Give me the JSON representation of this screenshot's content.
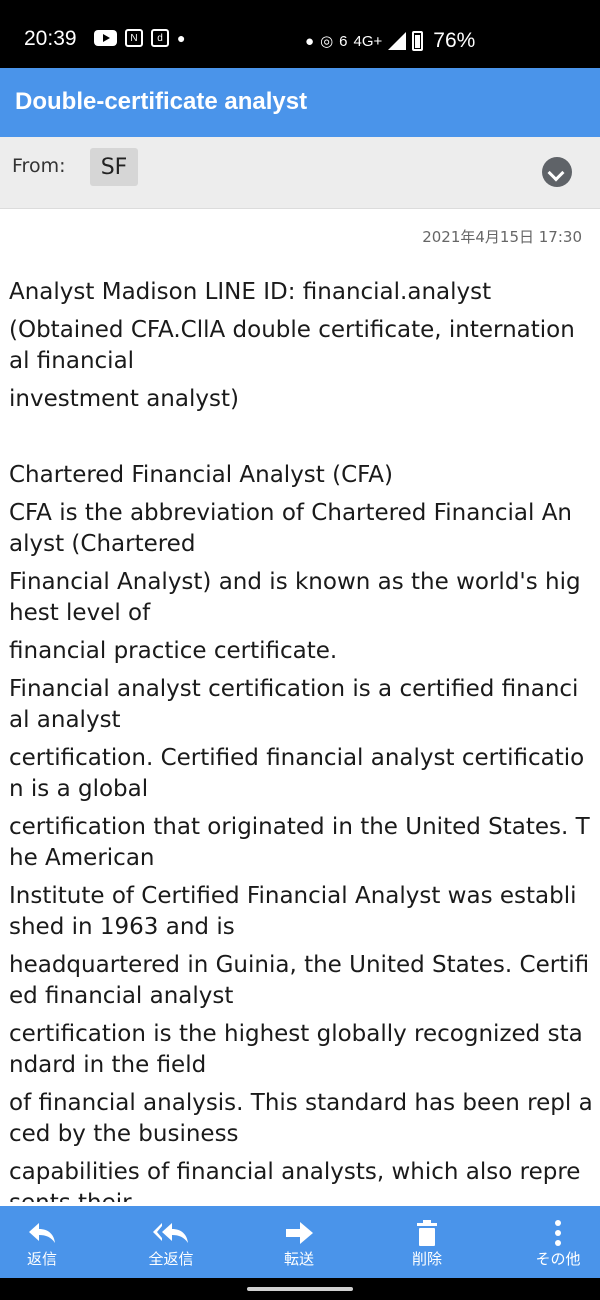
{
  "status_bar": {
    "time": "20:39",
    "left_icons": [
      "youtube-icon",
      "news-icon",
      "docomo-icon",
      "dot-icon"
    ],
    "signal_text": "6",
    "network": "4G+",
    "battery": "76%"
  },
  "header": {
    "title": "Double-certificate analyst"
  },
  "from": {
    "label": "From:",
    "sender_initials": "SF"
  },
  "message": {
    "date": "2021年4月15日 17:30",
    "paragraphs": [
      "Analyst Madison LINE ID: financial.analyst",
      "(Obtained CFA.CllA double certificate, internation al financial",
      "investment analyst)",
      "",
      "Chartered Financial Analyst (CFA)",
      "CFA is the abbreviation of Chartered Financial An alyst (Chartered",
      "Financial Analyst) and is known as the world's hig hest level of",
      "financial practice certificate.",
      "Financial analyst certification is a certified financi al analyst",
      "certification. Certified financial analyst certificatio n is a global",
      "certification that originated in the United States. T he American",
      "Institute of Certified Financial Analyst was establi shed in 1963 and is",
      "headquartered in Guinia, the United States. Certifi ed financial analyst",
      "certification is the highest globally recognized sta ndard in the field",
      "of financial analysis. This standard has been repl aced by the business",
      "capabilities of financial analysts, which also repre sents their"
    ]
  },
  "actions": [
    {
      "label": "返信",
      "icon": "reply-icon"
    },
    {
      "label": "全返信",
      "icon": "reply-all-icon"
    },
    {
      "label": "転送",
      "icon": "forward-icon"
    },
    {
      "label": "削除",
      "icon": "delete-icon"
    },
    {
      "label": "その他",
      "icon": "more-icon"
    }
  ],
  "colors": {
    "accent": "#4a94ea",
    "from_bg": "#ededed"
  }
}
